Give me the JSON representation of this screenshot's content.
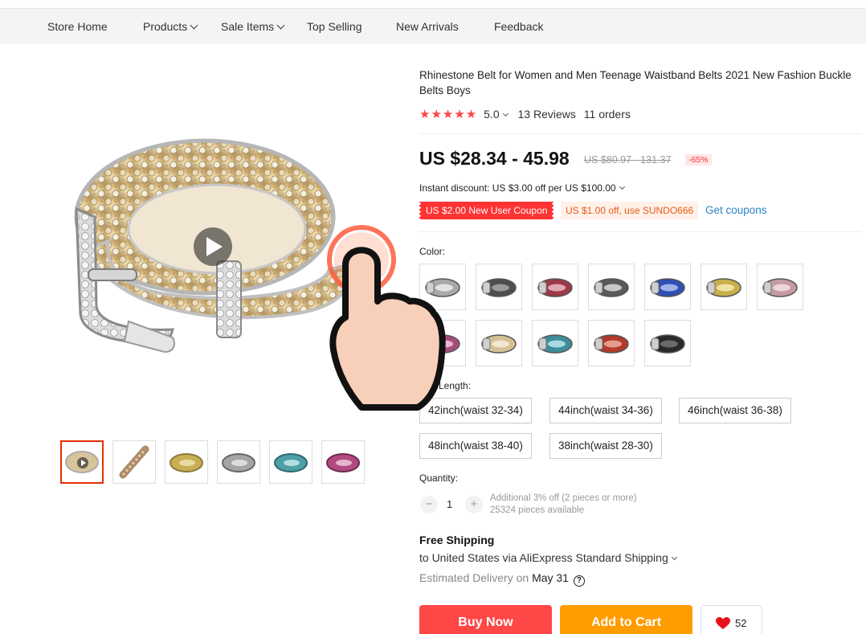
{
  "nav": {
    "items": [
      {
        "label": "Store Home",
        "has_dropdown": false
      },
      {
        "label": "Products",
        "has_dropdown": true
      },
      {
        "label": "Sale Items",
        "has_dropdown": true
      },
      {
        "label": "Top Selling",
        "has_dropdown": false
      },
      {
        "label": "New Arrivals",
        "has_dropdown": false
      },
      {
        "label": "Feedback",
        "has_dropdown": false
      }
    ]
  },
  "gallery": {
    "main_image_icon": "play-icon",
    "thumbnail_count": 6
  },
  "product": {
    "title": "Rhinestone Belt for Women and Men Teenage Waistband Belts 2021 New Fashion Buckle Belts Boys",
    "stars": "★★★★★",
    "rating": "5.0",
    "reviews": "13 Reviews",
    "orders": "11 orders",
    "price": "US $28.34 - 45.98",
    "original_price": "US $80.97 - 131.37",
    "discount": "-65%",
    "instant_discount": "Instant discount: US $3.00 off per US $100.00",
    "coupon_new_user": "US $2.00 New User Coupon",
    "coupon_code": "US $1.00 off, use SUNDO666",
    "get_coupons": "Get coupons"
  },
  "color": {
    "label": "Color:",
    "swatch_count": 12
  },
  "belt_length": {
    "label": "Belt Length:",
    "options": [
      "42inch(waist 32-34)",
      "44inch(waist 34-36)",
      "46inch(waist 36-38)",
      "48inch(waist 38-40)",
      "38inch(waist 28-30)"
    ]
  },
  "quantity": {
    "label": "Quantity:",
    "value": "1",
    "minus": "−",
    "plus": "+",
    "note_line1": "Additional 3% off (2 pieces or more)",
    "note_line2": "25324 pieces available"
  },
  "shipping": {
    "title": "Free Shipping",
    "line": "to United States via AliExpress Standard Shipping",
    "eta_prefix": "Estimated Delivery on",
    "eta_date": "May 31",
    "help": "?"
  },
  "actions": {
    "buy_now": "Buy Now",
    "add_to_cart": "Add to Cart",
    "wishlist_count": "52"
  },
  "colors": {
    "accent_red": "#ff4747",
    "cart_orange": "#ff9c00",
    "star_red": "#ff4444",
    "link_blue": "#2b86c7",
    "hand_highlight": "#ff5a3c"
  }
}
